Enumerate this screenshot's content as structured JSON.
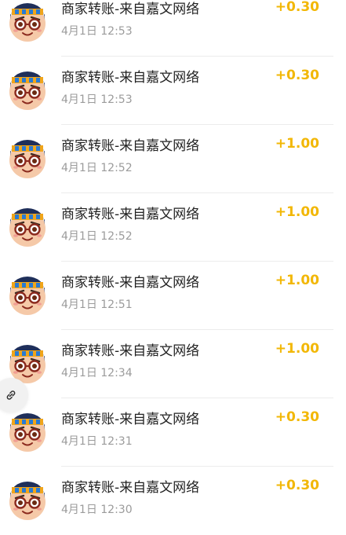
{
  "transactions": [
    {
      "title": "商家转账-来自嘉文网络",
      "time": "4月1日 12:53",
      "amount": "+0.30"
    },
    {
      "title": "商家转账-来自嘉文网络",
      "time": "4月1日 12:53",
      "amount": "+0.30"
    },
    {
      "title": "商家转账-来自嘉文网络",
      "time": "4月1日 12:52",
      "amount": "+1.00"
    },
    {
      "title": "商家转账-来自嘉文网络",
      "time": "4月1日 12:52",
      "amount": "+1.00"
    },
    {
      "title": "商家转账-来自嘉文网络",
      "time": "4月1日 12:51",
      "amount": "+1.00"
    },
    {
      "title": "商家转账-来自嘉文网络",
      "time": "4月1日 12:34",
      "amount": "+1.00"
    },
    {
      "title": "商家转账-来自嘉文网络",
      "time": "4月1日 12:31",
      "amount": "+0.30"
    },
    {
      "title": "商家转账-来自嘉文网络",
      "time": "4月1日 12:30",
      "amount": "+0.30"
    }
  ],
  "icons": {
    "avatar": "cartoon-avatar-icon",
    "floating": "link-icon"
  },
  "colors": {
    "amount": "#f2b705",
    "title": "#222222",
    "time": "#9b9b9b",
    "divider": "#ececec"
  }
}
